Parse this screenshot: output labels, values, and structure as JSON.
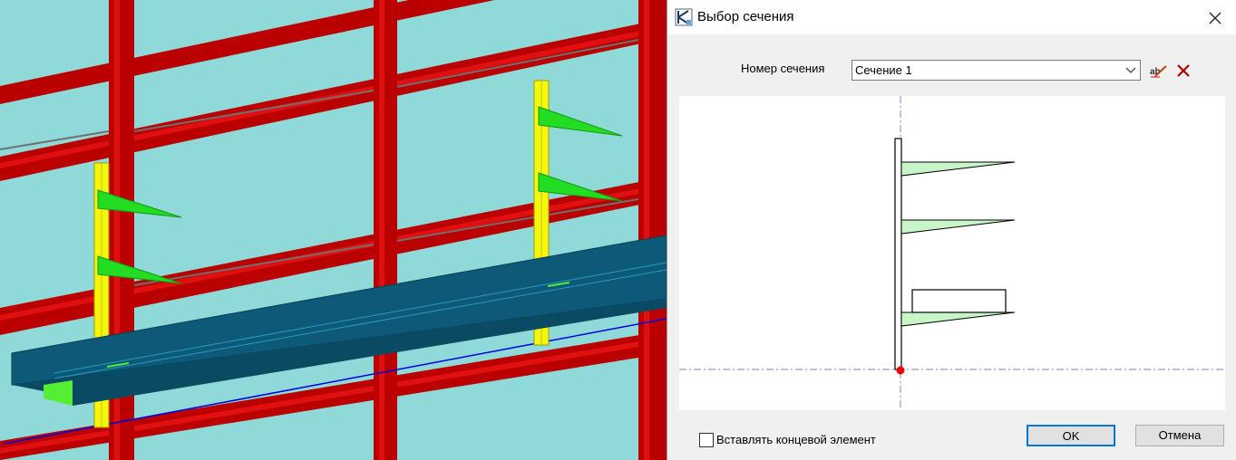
{
  "dialog": {
    "title": "Выбор сечения",
    "section_label": "Номер сечения",
    "section_value": "Сечение 1",
    "end_element_label": "Вставлять концевой элемент",
    "end_element_checked": false,
    "ok_label": "OK",
    "cancel_label": "Отмена"
  },
  "colors": {
    "frame_red": "#cc0000",
    "glass": "#8fd9d9",
    "post_yellow": "#f5f510",
    "bracket_green": "#22dd22",
    "beam_blue": "#0d5a78",
    "accent_blue": "#0078d7"
  },
  "icons": {
    "title": "section-tool-icon",
    "close": "close-icon",
    "chevron": "chevron-down-icon",
    "rename": "edit-text-icon",
    "delete": "delete-x-icon"
  }
}
